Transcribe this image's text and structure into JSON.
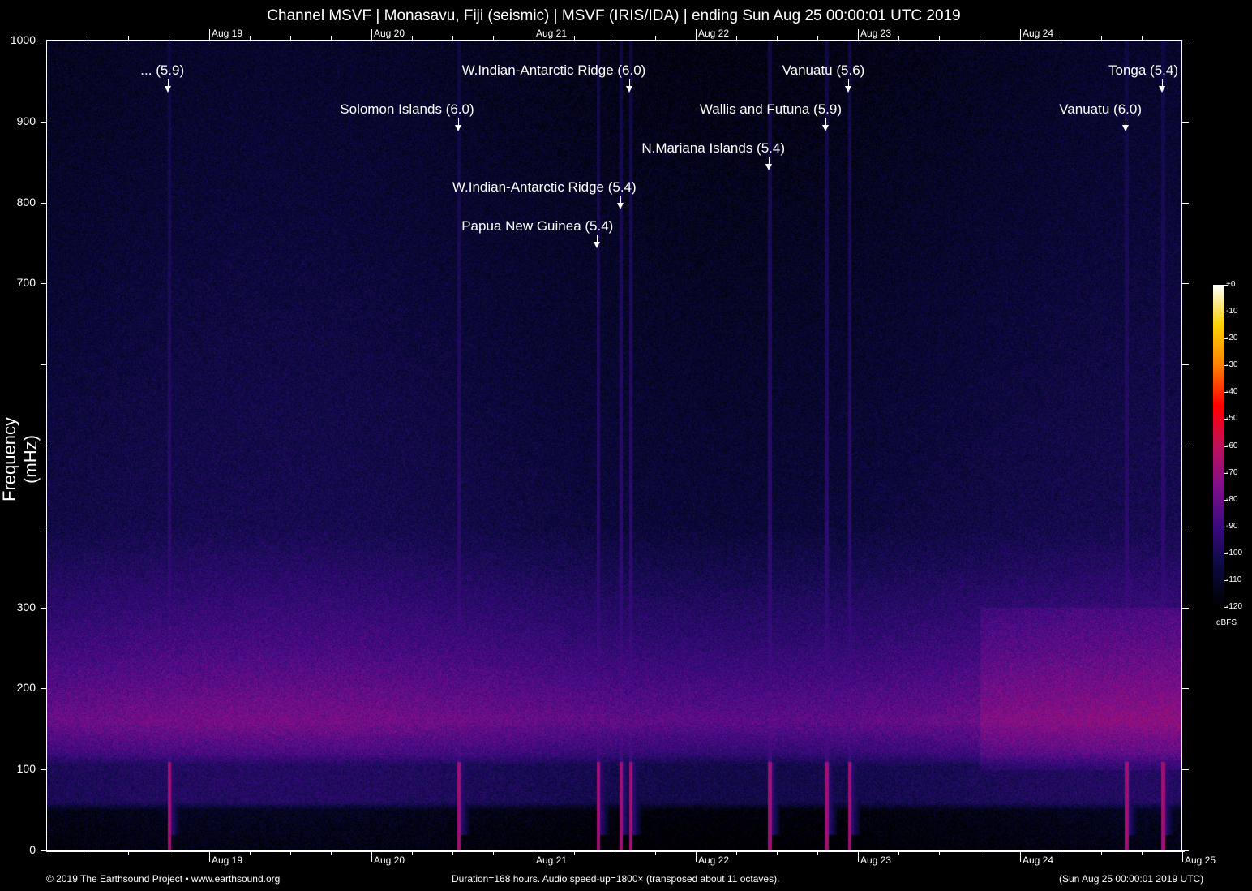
{
  "chart_data": {
    "type": "heatmap",
    "title": "Channel MSVF | Monasavu, Fiji (seismic) | MSVF (IRIS/IDA) | ending Sun Aug 25 00:00:01 UTC 2019",
    "ylabel": "Frequency (mHz)",
    "ylim": [
      0,
      1000
    ],
    "ytick_labels": [
      {
        "value": 0,
        "label": "0"
      },
      {
        "value": 100,
        "label": "100"
      },
      {
        "value": 200,
        "label": "200"
      },
      {
        "value": 300,
        "label": "300"
      },
      {
        "value": 400,
        "label": ""
      },
      {
        "value": 500,
        "label": ""
      },
      {
        "value": 600,
        "label": ""
      },
      {
        "value": 700,
        "label": "700"
      },
      {
        "value": 800,
        "label": "800"
      },
      {
        "value": 900,
        "label": "900"
      },
      {
        "value": 1000,
        "label": "1000"
      }
    ],
    "xlim_hours": [
      0,
      168
    ],
    "xtick_labels": [
      {
        "hour": 24,
        "label": "Aug 19"
      },
      {
        "hour": 48,
        "label": "Aug 20"
      },
      {
        "hour": 72,
        "label": "Aug 21"
      },
      {
        "hour": 96,
        "label": "Aug 22"
      },
      {
        "hour": 120,
        "label": "Aug 23"
      },
      {
        "hour": 144,
        "label": "Aug 24"
      },
      {
        "hour": 168,
        "label": "Aug 25"
      }
    ],
    "colorbar": {
      "unit": "dBFS",
      "range": [
        -120,
        0
      ],
      "ticks": [
        "+0",
        "-10",
        "-20",
        "-30",
        "-40",
        "-50",
        "-60",
        "-70",
        "-80",
        "-90",
        "-100",
        "-110",
        "-120"
      ],
      "colors": [
        "#000000",
        "#0a0a40",
        "#3a0a80",
        "#80108a",
        "#c0105a",
        "#ff0000",
        "#ff8000",
        "#ffd000",
        "#ffffff"
      ]
    },
    "events": [
      {
        "label": "... (5.9)",
        "hour": 17.9,
        "row": 1
      },
      {
        "label": "Solomon Islands (6.0)",
        "hour": 60.8,
        "row": 2
      },
      {
        "label": "W.Indian-Antarctic Ridge (6.0)",
        "hour": 86.2,
        "row": 1
      },
      {
        "label": "W.Indian-Antarctic Ridge (5.4)",
        "hour": 84.8,
        "row": 4
      },
      {
        "label": "Papua New Guinea (5.4)",
        "hour": 81.4,
        "row": 5
      },
      {
        "label": "N.Mariana Islands (5.4)",
        "hour": 106.8,
        "row": 3
      },
      {
        "label": "Wallis and Futuna (5.9)",
        "hour": 115.2,
        "row": 2
      },
      {
        "label": "Vanuatu (5.6)",
        "hour": 118.6,
        "row": 1
      },
      {
        "label": "Vanuatu (6.0)",
        "hour": 159.6,
        "row": 2
      },
      {
        "label": "Tonga (5.4)",
        "hour": 165.0,
        "row": 1
      }
    ],
    "noise_profile_db": [
      {
        "freq": 0,
        "db": -118
      },
      {
        "freq": 50,
        "db": -115
      },
      {
        "freq": 60,
        "db": -100
      },
      {
        "freq": 105,
        "db": -100
      },
      {
        "freq": 120,
        "db": -90
      },
      {
        "freq": 160,
        "db": -80
      },
      {
        "freq": 250,
        "db": -90
      },
      {
        "freq": 400,
        "db": -104
      },
      {
        "freq": 1000,
        "db": -113
      }
    ]
  },
  "footer": {
    "left": "© 2019 The Earthsound Project • www.earthsound.org",
    "center": "Duration=168 hours. Audio speed-up=1800× (transposed about 11 octaves).",
    "right": "(Sun Aug 25 00:00:01 2019 UTC)"
  }
}
